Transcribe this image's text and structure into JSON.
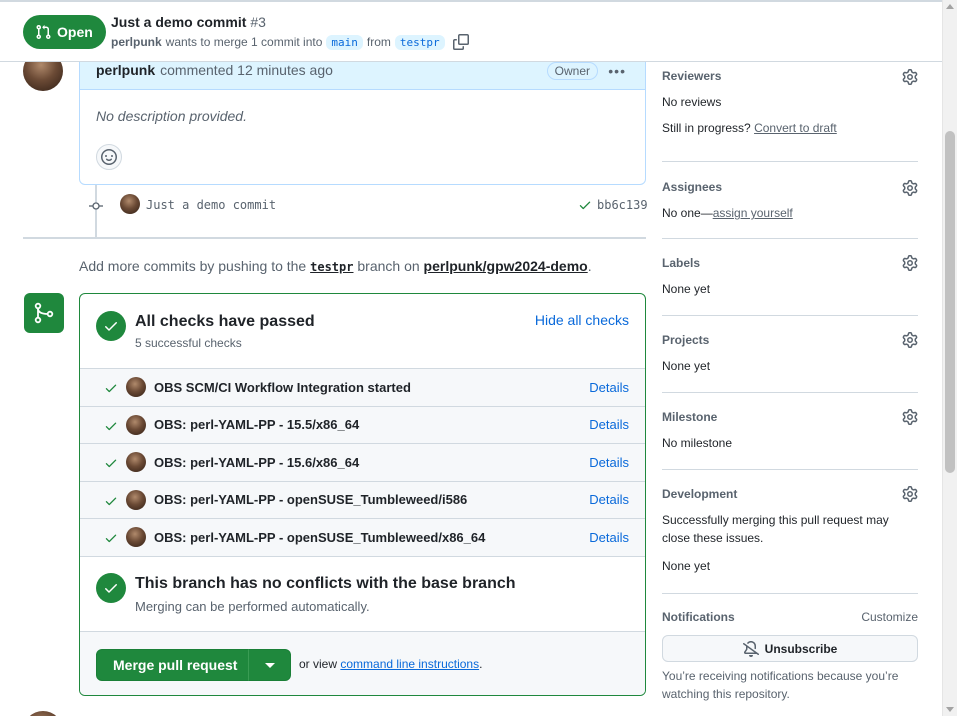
{
  "header": {
    "state_label": "Open",
    "title": "Just a demo commit",
    "number": "#3",
    "author": "perlpunk",
    "meta_text": "wants to merge 1 commit into",
    "base_branch": "main",
    "from_text": "from",
    "head_branch": "testpr"
  },
  "comment": {
    "author": "perlpunk",
    "time": "commented 12 minutes ago",
    "badge": "Owner",
    "body": "No description provided."
  },
  "commit": {
    "message": "Just a demo commit",
    "sha": "bb6c139"
  },
  "push_hint": {
    "prefix": "Add more commits by pushing to the",
    "branch": "testpr",
    "middle": "branch on",
    "repo": "perlpunk/gpw2024-demo",
    "suffix": "."
  },
  "checks": {
    "title": "All checks have passed",
    "subtitle": "5 successful checks",
    "toggle_label": "Hide all checks",
    "details_label": "Details",
    "items": [
      {
        "name": "OBS SCM/CI Workflow Integration started"
      },
      {
        "name": "OBS: perl-YAML-PP - 15.5/x86_64"
      },
      {
        "name": "OBS: perl-YAML-PP - 15.6/x86_64"
      },
      {
        "name": "OBS: perl-YAML-PP - openSUSE_Tumbleweed/i586"
      },
      {
        "name": "OBS: perl-YAML-PP - openSUSE_Tumbleweed/x86_64"
      }
    ]
  },
  "conflicts": {
    "title": "This branch has no conflicts with the base branch",
    "subtitle": "Merging can be performed automatically."
  },
  "merge": {
    "button_label": "Merge pull request",
    "cli_prefix": "or view",
    "cli_link": "command line instructions",
    "cli_suffix": "."
  },
  "sidebar": {
    "reviewers": {
      "heading": "Reviewers",
      "value": "No reviews",
      "progress_text": "Still in progress?",
      "draft_link": "Convert to draft"
    },
    "assignees": {
      "heading": "Assignees",
      "value": "No one—",
      "link": "assign yourself"
    },
    "labels": {
      "heading": "Labels",
      "value": "None yet"
    },
    "projects": {
      "heading": "Projects",
      "value": "None yet"
    },
    "milestone": {
      "heading": "Milestone",
      "value": "No milestone"
    },
    "development": {
      "heading": "Development",
      "description": "Successfully merging this pull request may close these issues.",
      "value": "None yet"
    },
    "notifications": {
      "heading": "Notifications",
      "customize": "Customize",
      "button": "Unsubscribe",
      "description": "You’re receiving notifications because you’re watching this repository."
    }
  },
  "colors": {
    "success": "#1f883d",
    "link": "#0969da",
    "muted": "#59636e",
    "border": "#d1d9e0"
  }
}
